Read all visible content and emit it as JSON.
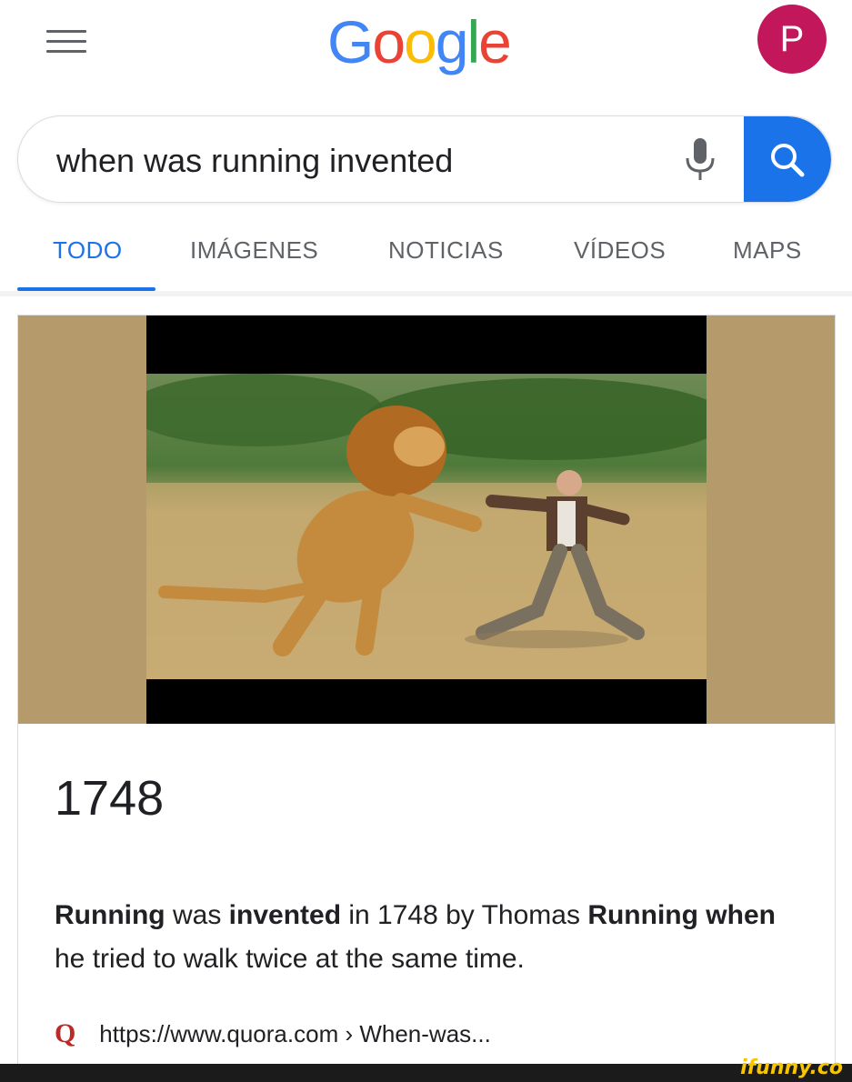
{
  "header": {
    "logo_letters": [
      {
        "char": "G",
        "color": "#4285F4"
      },
      {
        "char": "o",
        "color": "#EA4335"
      },
      {
        "char": "o",
        "color": "#FBBC05"
      },
      {
        "char": "g",
        "color": "#4285F4"
      },
      {
        "char": "l",
        "color": "#34A853"
      },
      {
        "char": "e",
        "color": "#EA4335"
      }
    ],
    "avatar_letter": "P",
    "avatar_color": "#c2185b"
  },
  "search": {
    "query": "when was running invented",
    "mic_icon": "microphone-icon",
    "search_icon": "magnifier-icon",
    "button_color": "#1a73e8"
  },
  "tabs": [
    {
      "label": "TODO",
      "active": true
    },
    {
      "label": "IMÁGENES",
      "active": false
    },
    {
      "label": "NOTICIAS",
      "active": false
    },
    {
      "label": "VÍDEOS",
      "active": false
    },
    {
      "label": "MAPS",
      "active": false
    }
  ],
  "result": {
    "answer": "1748",
    "snippet_parts": [
      {
        "text": "Running",
        "bold": true
      },
      {
        "text": " was ",
        "bold": false
      },
      {
        "text": "invented",
        "bold": true
      },
      {
        "text": " in 1748 by Thomas ",
        "bold": false
      },
      {
        "text": "Running",
        "bold": true
      },
      {
        "text": " ",
        "bold": false
      },
      {
        "text": "when",
        "bold": true
      },
      {
        "text": " he tried to walk twice at the same time.",
        "bold": false
      }
    ],
    "source_icon": "Q",
    "source_url": "https://www.quora.com › When-was..."
  },
  "watermark": "ifunny.co"
}
